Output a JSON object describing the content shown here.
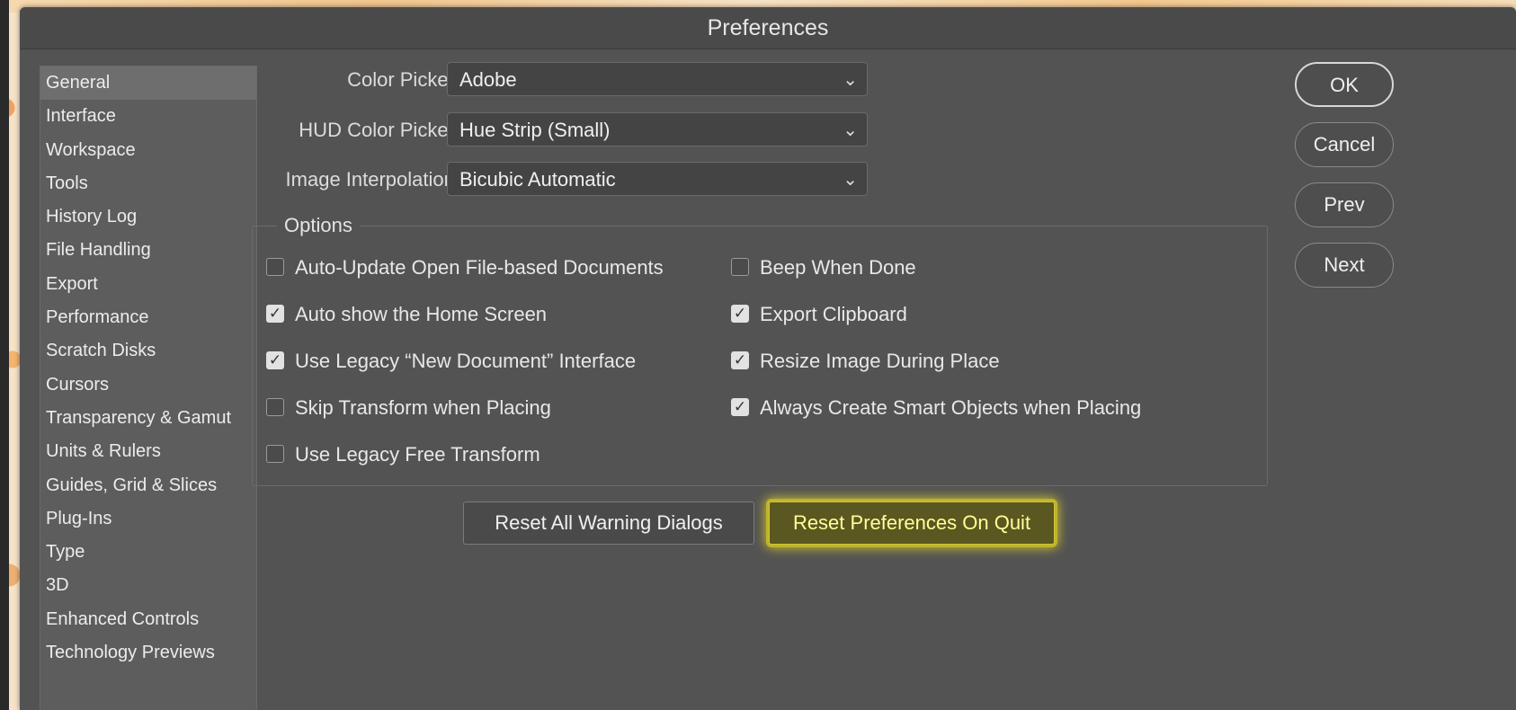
{
  "window": {
    "title": "Preferences"
  },
  "sidebar": {
    "items": [
      {
        "label": "General",
        "selected": true
      },
      {
        "label": "Interface"
      },
      {
        "label": "Workspace"
      },
      {
        "label": "Tools"
      },
      {
        "label": "History Log"
      },
      {
        "label": "File Handling"
      },
      {
        "label": "Export"
      },
      {
        "label": "Performance"
      },
      {
        "label": "Scratch Disks"
      },
      {
        "label": "Cursors"
      },
      {
        "label": "Transparency & Gamut"
      },
      {
        "label": "Units & Rulers"
      },
      {
        "label": "Guides, Grid & Slices"
      },
      {
        "label": "Plug-Ins"
      },
      {
        "label": "Type"
      },
      {
        "label": "3D"
      },
      {
        "label": "Enhanced Controls"
      },
      {
        "label": "Technology Previews"
      }
    ]
  },
  "fields": {
    "color_picker": {
      "label": "Color Picker:",
      "value": "Adobe"
    },
    "hud_color_picker": {
      "label": "HUD Color Picker:",
      "value": "Hue Strip (Small)"
    },
    "image_interpolation": {
      "label": "Image Interpolation:",
      "value": "Bicubic Automatic"
    }
  },
  "options": {
    "title": "Options",
    "left": [
      {
        "label": "Auto-Update Open File-based Documents",
        "checked": false
      },
      {
        "label": "Auto show the Home Screen",
        "checked": true
      },
      {
        "label": "Use Legacy “New Document” Interface",
        "checked": true
      },
      {
        "label": "Skip Transform when Placing",
        "checked": false
      },
      {
        "label": "Use Legacy Free Transform",
        "checked": false
      }
    ],
    "right": [
      {
        "label": "Beep When Done",
        "checked": false
      },
      {
        "label": "Export Clipboard",
        "checked": true
      },
      {
        "label": "Resize Image During Place",
        "checked": true
      },
      {
        "label": "Always Create Smart Objects when Placing",
        "checked": true
      }
    ]
  },
  "buttons": {
    "reset_warnings": "Reset All Warning Dialogs",
    "reset_prefs": "Reset Preferences On Quit",
    "ok": "OK",
    "cancel": "Cancel",
    "prev": "Prev",
    "next": "Next"
  },
  "colors": {
    "dialog_bg": "#535353",
    "highlight": "#cfc43a"
  }
}
